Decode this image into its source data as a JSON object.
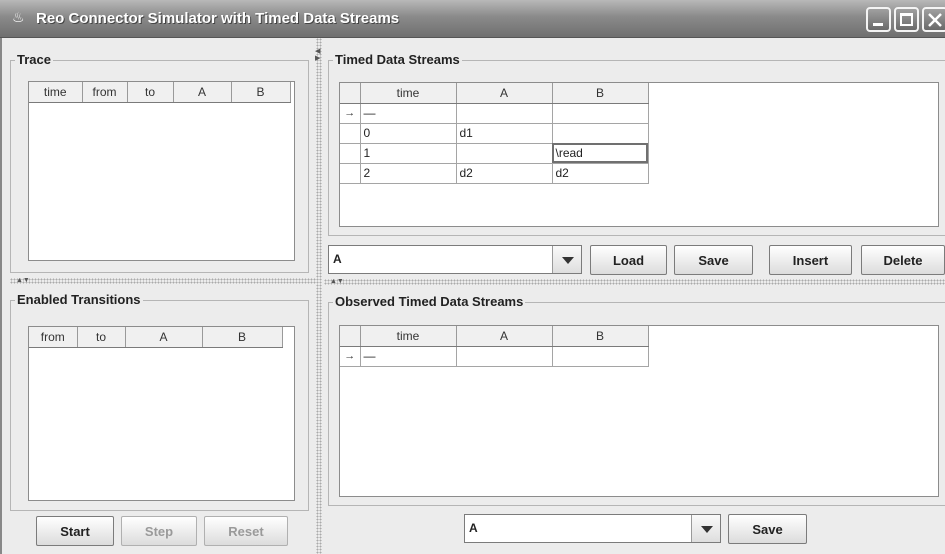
{
  "window": {
    "title": "Reo Connector Simulator with Timed Data Streams"
  },
  "trace": {
    "title": "Trace",
    "columns": [
      "time",
      "from",
      "to",
      "A",
      "B"
    ]
  },
  "enabled": {
    "title": "Enabled Transitions",
    "columns": [
      "from",
      "to",
      "A",
      "B"
    ]
  },
  "sim_buttons": {
    "start": "Start",
    "step": "Step",
    "reset": "Reset"
  },
  "streams": {
    "title": "Timed Data Streams",
    "columns": [
      "time",
      "A",
      "B"
    ],
    "rows": [
      {
        "marker": "→",
        "time": "—",
        "A": "",
        "B": ""
      },
      {
        "marker": "",
        "time": "0",
        "A": "d1",
        "B": ""
      },
      {
        "marker": "",
        "time": "1",
        "A": "",
        "B": "\\read"
      },
      {
        "marker": "",
        "time": "2",
        "A": "d2",
        "B": "d2"
      }
    ],
    "combo_value": "A",
    "buttons": {
      "load": "Load",
      "save": "Save",
      "insert": "Insert",
      "delete": "Delete"
    }
  },
  "observed": {
    "title": "Observed Timed Data Streams",
    "columns": [
      "time",
      "A",
      "B"
    ],
    "rows": [
      {
        "marker": "→",
        "time": "—",
        "A": "",
        "B": ""
      }
    ],
    "combo_value": "A",
    "save": "Save"
  }
}
